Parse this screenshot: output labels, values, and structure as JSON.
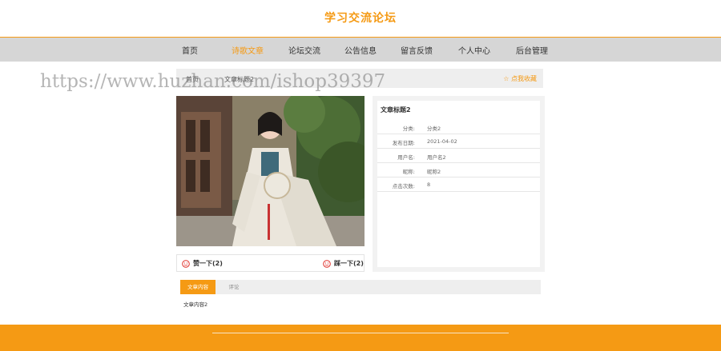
{
  "site": {
    "title": "学习交流论坛"
  },
  "nav": {
    "items": [
      {
        "label": "首页",
        "active": false
      },
      {
        "label": "诗歌文章",
        "active": true
      },
      {
        "label": "论坛交流",
        "active": false
      },
      {
        "label": "公告信息",
        "active": false
      },
      {
        "label": "留言反馈",
        "active": false
      },
      {
        "label": "个人中心",
        "active": false
      },
      {
        "label": "后台管理",
        "active": false
      }
    ]
  },
  "breadcrumb": {
    "home": "首页",
    "current": "文章标题2",
    "collect_label": "☆ 点我收藏"
  },
  "watermark": "https://www.huzhan.com/ishop39397",
  "votes": {
    "like_label": "赞一下(2)",
    "dislike_label": "踩一下(2)"
  },
  "article": {
    "title": "文章标题2",
    "fields": [
      {
        "label": "分类:",
        "value": "分类2"
      },
      {
        "label": "发布日期:",
        "value": "2021-04-02"
      },
      {
        "label": "用户名:",
        "value": "用户名2"
      },
      {
        "label": "昵称:",
        "value": "昵称2"
      },
      {
        "label": "点击次数:",
        "value": "8"
      }
    ]
  },
  "tabs": [
    {
      "label": "文章内容",
      "active": true
    },
    {
      "label": "评论",
      "active": false
    }
  ],
  "content": {
    "text": "文章内容2"
  },
  "colors": {
    "accent": "#f59a14",
    "nav_bg": "#d6d6d6",
    "footer_bg": "#f59a14"
  },
  "icons": {
    "collect": "star-icon",
    "like": "smile-icon",
    "dislike": "smile-icon"
  }
}
